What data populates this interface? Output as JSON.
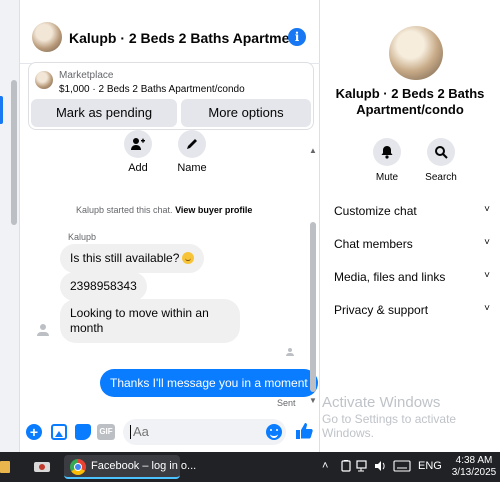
{
  "chat": {
    "title": "Kalupb · 2 Beds 2 Baths Apartme…",
    "marketplace": {
      "label": "Marketplace",
      "desc": "$1,000 · 2 Beds 2 Baths Apartment/condo",
      "pending_btn": "Mark as pending",
      "more_btn": "More options"
    },
    "actions": [
      {
        "label": "Add",
        "icon": "add-person-icon"
      },
      {
        "label": "Name",
        "icon": "pencil-icon"
      }
    ],
    "started_text": "Kalupb started this chat. ",
    "view_profile": "View buyer profile",
    "sender_name": "Kalupb",
    "messages_in": [
      "Is this still available?",
      "2398958343",
      "Looking to move within an month"
    ],
    "message_out": "Thanks I'll message you in a moment",
    "sent_status": "Sent",
    "composer": {
      "placeholder": "Aa",
      "gif_label": "GIF"
    }
  },
  "right_panel": {
    "title": "Kalupb · 2 Beds 2 Baths Apartment/condo",
    "actions": [
      {
        "label": "Mute",
        "icon": "bell-icon"
      },
      {
        "label": "Search",
        "icon": "search-icon"
      }
    ],
    "items": [
      "Customize chat",
      "Chat members",
      "Media, files and links",
      "Privacy & support"
    ]
  },
  "watermark": {
    "line1": "Activate Windows",
    "line2": "Go to Settings to activate Windows."
  },
  "taskbar": {
    "app_label": "Facebook – log in o...",
    "lang": "ENG",
    "time": "4:38 AM",
    "date": "3/13/2025"
  },
  "colors": {
    "accent": "#0a7cff",
    "info_blue": "#1877f2",
    "taskbar": "#202226"
  }
}
